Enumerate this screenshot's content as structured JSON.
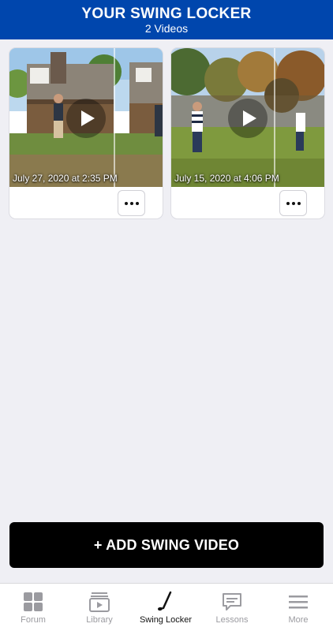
{
  "header": {
    "title": "YOUR SWING LOCKER",
    "subtitle": "2 Videos"
  },
  "videos": [
    {
      "date": "July 27, 2020 at 2:35 PM"
    },
    {
      "date": "July 15, 2020 at 4:06 PM"
    }
  ],
  "add_button_label": "+ ADD SWING VIDEO",
  "tabs": [
    {
      "label": "Forum",
      "icon": "grid-icon",
      "active": false
    },
    {
      "label": "Library",
      "icon": "video-library-icon",
      "active": false
    },
    {
      "label": "Swing Locker",
      "icon": "golf-club-icon",
      "active": true
    },
    {
      "label": "Lessons",
      "icon": "chat-bubble-icon",
      "active": false
    },
    {
      "label": "More",
      "icon": "hamburger-menu-icon",
      "active": false
    }
  ],
  "colors": {
    "header_bg": "#0046ad",
    "tab_inactive": "#9b9ba0",
    "tab_active": "#111111"
  }
}
